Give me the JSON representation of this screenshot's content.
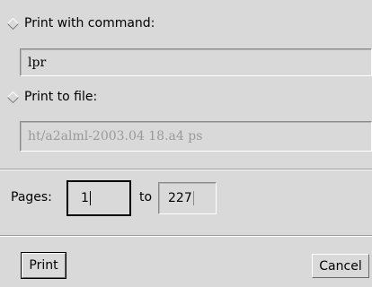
{
  "print_command": {
    "option_label": "Print with command:",
    "value": "lpr"
  },
  "print_file": {
    "option_label": "Print to file:",
    "value": "ht/a2alml-2003.04 18.a4 ps"
  },
  "pages": {
    "label": "Pages:",
    "from_value": "1",
    "to_label": "to",
    "to_value": "227"
  },
  "actions": {
    "print_label": "Print",
    "cancel_label": "Cancel"
  },
  "icons": [
    "radio-diamond-icon"
  ]
}
